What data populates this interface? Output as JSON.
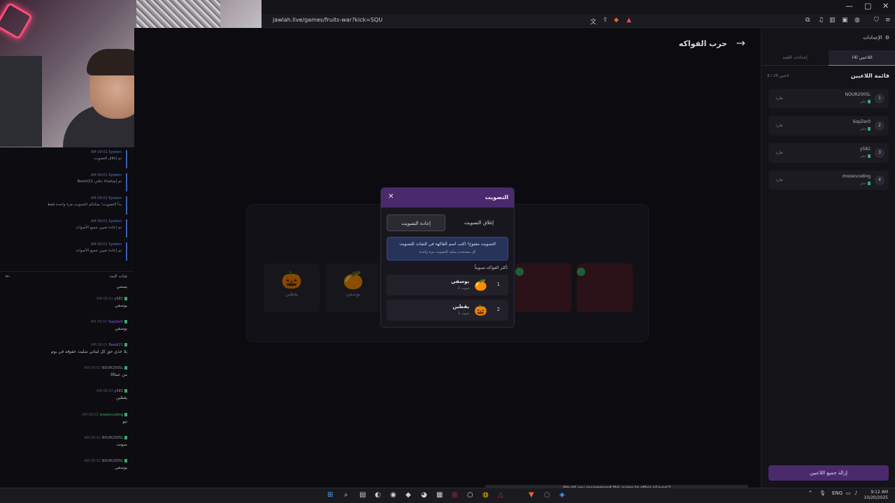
{
  "browser": {
    "url": "jawlah.live/games/fruits-war?kick=SQU",
    "window_controls": [
      "—",
      "▢",
      "✕"
    ]
  },
  "page": {
    "title": "حرب الفواكه"
  },
  "chat": {
    "system_messages": [
      {
        "time": "AM 09:01",
        "author": "System",
        "text": "تم إغلاق التصويت"
      },
      {
        "time": "AM 09:01",
        "author": "System",
        "text": "Beedi21 تم إضافة/لا تنافي"
      },
      {
        "time": "AM 09:01",
        "author": "System",
        "text": "بدأ التصويت! يمكنكم التصويت مرة واحدة فقط"
      },
      {
        "time": "AM 09:01",
        "author": "System",
        "text": "تم إعادة تعيين جميع الأصوات"
      },
      {
        "time": "AM 09:01",
        "author": "System",
        "text": "تم إعادة تعيين جميع الأصوات"
      }
    ],
    "header": "شات البث",
    "first_text": "يستني",
    "messages": [
      {
        "time": "AM 09:01",
        "name": "y581",
        "color": "gray",
        "text": "يوسفي"
      },
      {
        "time": "AM 09:01",
        "name": "SopZer0",
        "color": "purple",
        "text": "يوسفي"
      },
      {
        "time": "AM 09:01",
        "name": "Beedi21",
        "color": "purple",
        "text": "يلا خذي حق كل ليناني سليت حقوقه في يوم"
      },
      {
        "time": "AM 09:02",
        "name": "NOUR2005L",
        "color": "gray",
        "text": "من عيناااا"
      },
      {
        "time": "AM 09:02",
        "name": "y581",
        "color": "gray",
        "text": "يقطين"
      },
      {
        "time": "AM 09:02",
        "name": "mozencoding",
        "color": "green",
        "text": "تيو"
      },
      {
        "time": "AM 09:02",
        "name": "NOUR2005L",
        "color": "gray",
        "text": "صوتت"
      },
      {
        "time": "AM 09:02",
        "name": "NOUR2005L",
        "color": "gray",
        "text": "يوسفي"
      }
    ]
  },
  "board": {
    "fruits": [
      {
        "emoji": "🎃",
        "label": "يقطين"
      },
      {
        "emoji": "🍊",
        "label": "يوسفي"
      }
    ]
  },
  "modal": {
    "title": "التصويت",
    "close_icon": "✕",
    "reset_label": "إعادة التصويت",
    "close_vote_label": "إغلاق التصويت",
    "info_main": "التصويت مفتوح! اكتب اسم الفاكهة في الشات للتصويت",
    "info_sub": "كل مستخدم يمكنه التصويت مرة واحدة",
    "top_label": "أكثر الفواكه تصويتاً:",
    "results": [
      {
        "rank": "1",
        "emoji": "🍊",
        "name": "يوسفي",
        "votes": "2 صوت"
      },
      {
        "rank": "2",
        "emoji": "🎃",
        "name": "يقطين",
        "votes": "1 صوت"
      }
    ]
  },
  "sidebar": {
    "settings_label": "الإعدادات",
    "tab_players": "اللاعبين (4)",
    "tab_game_settings": "إعدادات اللعبة",
    "players_header": "قائمة اللاعبين",
    "players_count": "4 / 25 لاعبين",
    "kick_label": "طرد",
    "player_role": "جاهز",
    "players": [
      {
        "num": "1",
        "name": "NOUR2005L"
      },
      {
        "num": "2",
        "name": "SopZer0"
      },
      {
        "num": "3",
        "name": "y581"
      },
      {
        "num": "4",
        "name": "mozencoding"
      }
    ],
    "remove_all": "إزالة جميع اللاعبين"
  },
  "taskbar": {
    "lang": "ENG",
    "time": "9:12 AM",
    "date": "10/20/2025",
    "caption": "Would you recommend this game to other players?"
  },
  "colors": {
    "accent_purple": "#4a2a6c",
    "info_blue": "#26345a",
    "system_blue": "#3d5baf"
  }
}
